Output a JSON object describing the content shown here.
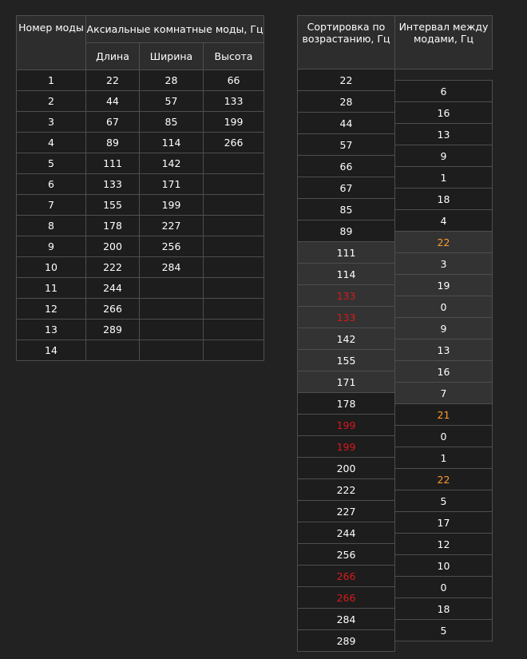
{
  "modes_table": {
    "header": {
      "mode_number": "Номер моды",
      "axial_modes": "Аксиальные комнатные моды, Гц",
      "length": "Длина",
      "width": "Ширина",
      "height": "Высота"
    },
    "rows": [
      [
        "1",
        "22",
        "28",
        "66"
      ],
      [
        "2",
        "44",
        "57",
        "133"
      ],
      [
        "3",
        "67",
        "85",
        "199"
      ],
      [
        "4",
        "89",
        "114",
        "266"
      ],
      [
        "5",
        "111",
        "142",
        ""
      ],
      [
        "6",
        "133",
        "171",
        ""
      ],
      [
        "7",
        "155",
        "199",
        ""
      ],
      [
        "8",
        "178",
        "227",
        ""
      ],
      [
        "9",
        "200",
        "256",
        ""
      ],
      [
        "10",
        "222",
        "284",
        ""
      ],
      [
        "11",
        "244",
        "",
        ""
      ],
      [
        "12",
        "266",
        "",
        ""
      ],
      [
        "13",
        "289",
        "",
        ""
      ],
      [
        "14",
        "",
        "",
        ""
      ]
    ]
  },
  "sorted_table": {
    "header": "Сортировка по возрастанию, Гц",
    "values": [
      "22",
      "28",
      "44",
      "57",
      "66",
      "67",
      "85",
      "89",
      "111",
      "114",
      "133",
      "133",
      "142",
      "155",
      "171",
      "178",
      "199",
      "199",
      "200",
      "222",
      "227",
      "244",
      "256",
      "266",
      "266",
      "284",
      "289"
    ],
    "styles": [
      "",
      "",
      "",
      "",
      "",
      "",
      "",
      "",
      "hl",
      "hl",
      "hl red",
      "hl red",
      "hl",
      "hl",
      "hl",
      "",
      "red",
      "red",
      "",
      "",
      "",
      "",
      "",
      "red",
      "red",
      "",
      ""
    ]
  },
  "interval_table": {
    "header": "Интервал между модами, Гц",
    "values": [
      "6",
      "16",
      "13",
      "9",
      "1",
      "18",
      "4",
      "22",
      "3",
      "19",
      "0",
      "9",
      "13",
      "16",
      "7",
      "21",
      "0",
      "1",
      "22",
      "5",
      "17",
      "12",
      "10",
      "0",
      "18",
      "5"
    ],
    "styles": [
      "",
      "",
      "",
      "",
      "",
      "",
      "",
      "hl orange",
      "hl",
      "hl",
      "hl",
      "hl",
      "hl",
      "hl",
      "hl",
      "orange",
      "",
      "",
      "orange",
      "",
      "",
      "",
      "",
      "",
      "",
      ""
    ]
  },
  "colors": {
    "background": "#222222",
    "cell_dark": "#1d1d1d",
    "cell_highlight": "#333333",
    "border": "#4e4e4e",
    "red": "#d9191b",
    "orange": "#ff9b2d"
  }
}
